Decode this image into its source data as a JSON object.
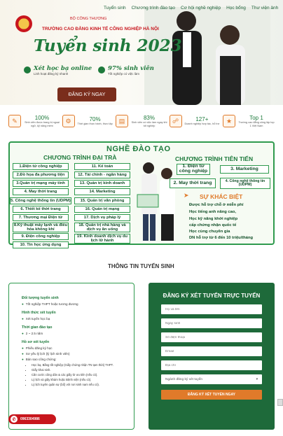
{
  "nav": [
    "Tuyển sinh",
    "Chương trình đào tạo",
    "Cơ hội nghề nghiệp",
    "Học bổng",
    "Thư viện ảnh"
  ],
  "hero": {
    "school_sub": "BỘ CÔNG THƯƠNG",
    "school": "TRƯỜNG CAO ĐẲNG KINH TẾ CÔNG NGHIỆP HÀ NỘI",
    "headline": "Tuyển sinh 2023",
    "feature1": {
      "title": "Xét học bạ online",
      "sub": "Linh hoạt đăng ký nhanh"
    },
    "feature2": {
      "title": "97% sinh viên",
      "sub": "Tốt nghiệp có việc làm"
    },
    "register": "ĐĂNG KÝ NGAY"
  },
  "stats": [
    {
      "value": "100%",
      "label": "Sinh viên được trang bị ngoại ngữ, kỹ năng mềm"
    },
    {
      "value": "70%",
      "label": "Thời gian thực hành, thực tập"
    },
    {
      "value": "83%",
      "label": "Sinh viên có việc làm ngay khi tốt nghiệp"
    },
    {
      "value": "127+",
      "label": "Doanh nghiệp hợp tác, hỗ trợ"
    },
    {
      "value": "Top 1",
      "label": "Trường cao đẳng công lập top 1 Việt Nam"
    }
  ],
  "programs": {
    "title": "NGHỀ ĐÀO TẠO",
    "regular_title": "CHƯƠNG TRÌNH ĐẠI TRÀ",
    "col1": [
      "1.Điện tử công nghiệp",
      "2.Đồ họa đa phương tiện",
      "3.Quản trị mạng máy tính",
      "4. May thời trang",
      "5. Công nghệ thông tin (UDPM)",
      "6. Thiết kế thời trang",
      "7. Thương mại Điện tử",
      "8.Kỹ thuật máy lạnh và điều hòa không khí",
      "9. Điện công nghiệp",
      "10. Tin học ứng dụng"
    ],
    "col2": [
      "11. Kế toán",
      "12. Tài chính - ngân hàng",
      "13. Quản trị kinh doanh",
      "14. Marketing",
      "15. Quản trị văn phòng",
      "16. Quản trị mạng",
      "17. Dịch vụ pháp lý",
      "18. Quản trị nhà hàng và dịch vụ ăn uống",
      "19. Kinh doanh dịch vụ du lịch lữ hành"
    ],
    "advanced_title": "CHƯƠNG TRÌNH TIÊN TIẾN",
    "advanced": [
      "1. Điện tử công nghiệp",
      "3. Marketing",
      "2. May thời trang",
      "4. Công nghệ thông tin (UDPM)"
    ],
    "diff_title": "SỰ KHÁC BIỆT",
    "diff": [
      "Được hỗ trợ chỗ ở miễn phí",
      "Học tiếng anh nâng cao,",
      "Học kỹ năng khởi nghiệp",
      "cấp chứng nhận quốc tế",
      "Học cùng chuyên gia",
      "DN hỗ trợ từ 6 đến 10 triệu/tháng"
    ]
  },
  "info": {
    "title": "THÔNG TIN TUYỂN SINH",
    "sections": [
      {
        "heading": "Đối tượng tuyển sinh",
        "items": [
          "Tốt nghiệp THPT hoặc tương đương"
        ]
      },
      {
        "heading": "Hình thức xét tuyển",
        "items": [
          "Xét tuyển học bạ"
        ]
      },
      {
        "heading": "Thời gian đào tạo",
        "items": [
          "2 ~ 2.5 năm"
        ]
      },
      {
        "heading": "Hồ sơ xét tuyển",
        "items": [
          "Phiếu đăng ký học",
          "Sơ yếu lý lịch (lý lịch sinh viên)",
          "Bản sao công chứng:"
        ]
      }
    ],
    "docs": [
      "Học bạ, Bằng tốt nghiệp (Giấy chứng nhận TN tạm thời) THPT.",
      "Giấy khai sinh.",
      "Căn cước công dân & các giấy tờ ưu tiên (nếu có).",
      "Lý lịch và giấy khám hoặc Bệnh viện (nếu có).",
      "Lý lịch tuyên quân sự (bổ) với nơi sinh nam nếu có)."
    ]
  },
  "form": {
    "title": "ĐĂNG KÝ XÉT TUYỂN TRỰC TUYẾN",
    "fields": [
      "Họ và tên",
      "Ngày sinh",
      "Số điện thoại",
      "Email",
      "Địa chỉ"
    ],
    "select": "Ngành đăng ký xét tuyển",
    "submit": "ĐĂNG KÝ XÉT TUYỂN NGAY"
  },
  "hotline": "0963304986",
  "colors": {
    "green": "#1e7a3c",
    "orange": "#e07a2a",
    "red": "#c8161d"
  }
}
